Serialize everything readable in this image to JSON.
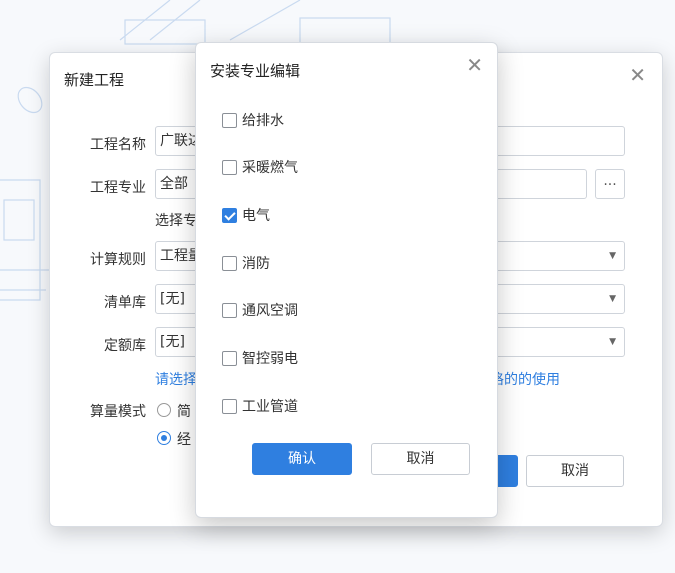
{
  "main_dialog": {
    "title": "新建工程",
    "fields": [
      {
        "label": "工程名称",
        "value": "广联达"
      },
      {
        "label": "工程专业",
        "value": "全部"
      },
      {
        "label": "计算规则",
        "value": "工程量"
      },
      {
        "label": "清单库",
        "value": "[无]"
      },
      {
        "label": "定额库",
        "value": "[无]"
      }
    ],
    "dots_label": "...",
    "select_note": "选择专",
    "link_left": "请选择",
    "link_right": "格的的使用",
    "mode_label": "算量模式",
    "radio_options": [
      {
        "label": "简",
        "selected": false
      },
      {
        "label": "经",
        "selected": true
      }
    ],
    "cancel_label": "取消"
  },
  "modal": {
    "title": "安装专业编辑",
    "options": [
      {
        "label": "给排水",
        "checked": false
      },
      {
        "label": "采暖燃气",
        "checked": false
      },
      {
        "label": "电气",
        "checked": true
      },
      {
        "label": "消防",
        "checked": false
      },
      {
        "label": "通风空调",
        "checked": false
      },
      {
        "label": "智控弱电",
        "checked": false
      },
      {
        "label": "工业管道",
        "checked": false
      }
    ],
    "confirm_label": "确认",
    "cancel_label": "取消"
  },
  "colors": {
    "accent": "#2f7fe0",
    "border": "#cfd4db"
  }
}
